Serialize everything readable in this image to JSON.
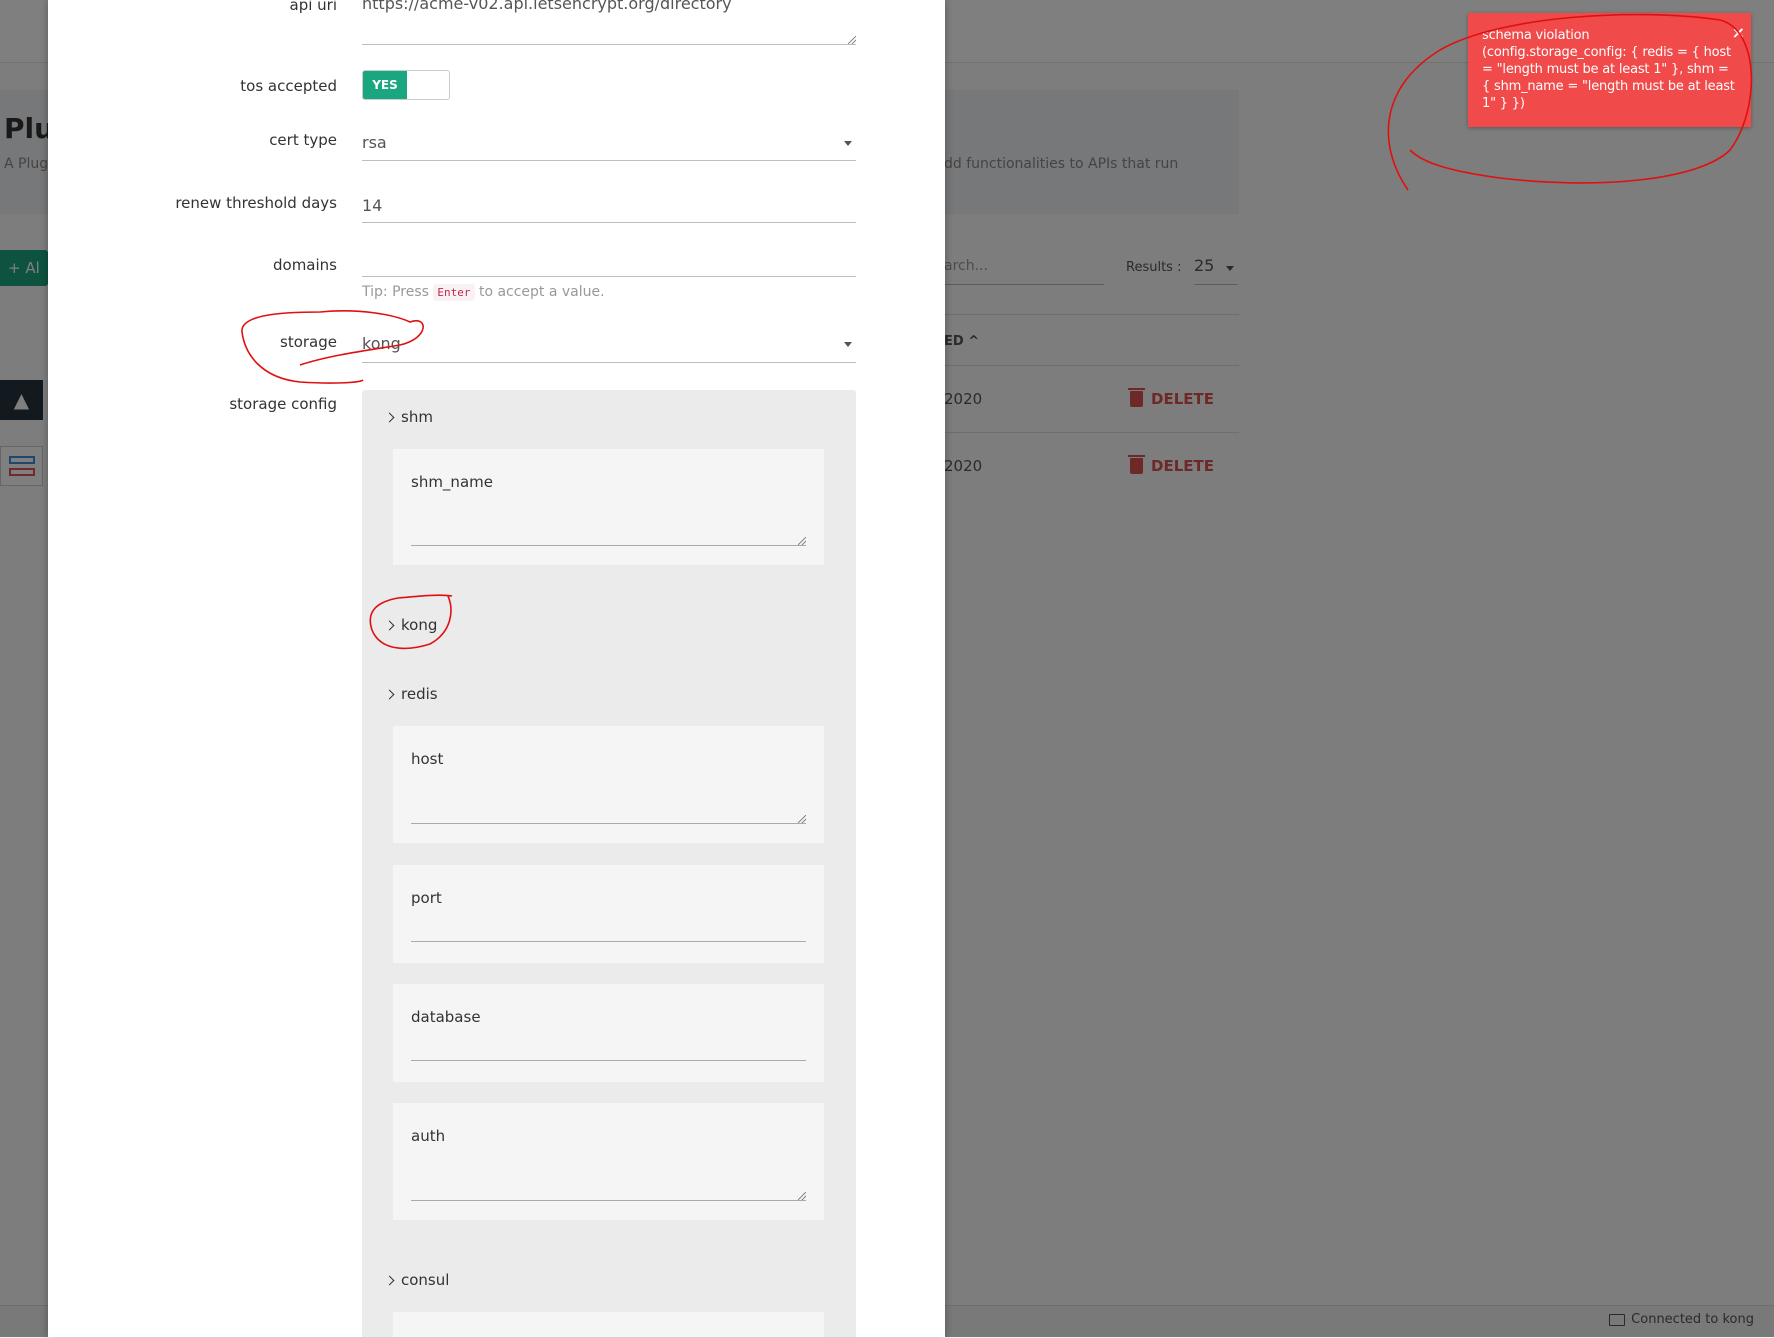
{
  "background_page": {
    "title": "Plu",
    "description_left": "A Plug behin",
    "description_right": "dd functionalities to APIs that run",
    "add_button_label": "+ Al",
    "search_placeholder": "arch...",
    "results_label": "Results :",
    "results_value": "25",
    "column_header": "ED ^",
    "rows": [
      {
        "date": "2020",
        "action": "DELETE"
      },
      {
        "date": "2020",
        "action": "DELETE"
      }
    ],
    "status_text": "Connected to kong"
  },
  "modal": {
    "api_uri": {
      "label": "api uri",
      "value": "https://acme-v02.api.letsencrypt.org/directory"
    },
    "tos_accepted": {
      "label": "tos accepted",
      "value": "YES"
    },
    "cert_type": {
      "label": "cert type",
      "value": "rsa"
    },
    "renew_threshold_days": {
      "label": "renew threshold days",
      "value": "14"
    },
    "domains": {
      "label": "domains",
      "value": "",
      "tip_prefix": "Tip: Press",
      "tip_key": "Enter",
      "tip_suffix": "to accept a value."
    },
    "storage": {
      "label": "storage",
      "value": "kong"
    },
    "storage_config": {
      "label": "storage config",
      "sections": {
        "shm": "shm",
        "shm_name": "shm_name",
        "kong": "kong",
        "redis": "redis",
        "host": "host",
        "port": "port",
        "database": "database",
        "auth": "auth",
        "consul": "consul"
      }
    }
  },
  "toast": {
    "message": "schema violation (config.storage_config: { redis = { host = \"length must be at least 1\" }, shm = { shm_name = \"length must be at least 1\" } })",
    "close": "×",
    "color": "#f04a4a"
  },
  "colors": {
    "accent": "#1aa67e",
    "danger": "#d9534f",
    "annotation": "#e01010"
  }
}
